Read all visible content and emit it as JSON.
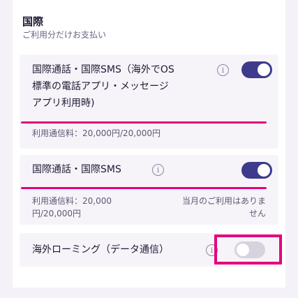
{
  "section": {
    "title": "国際",
    "subtitle": "ご利用分だけお支払い"
  },
  "rows": [
    {
      "title_lines": [
        "国際通話・国際SMS（海外でOS",
        "標準の電話アプリ・メッセージ",
        "アプリ利用時)"
      ],
      "info_icon": "info-icon",
      "toggle_state": "on",
      "fee_label": "利用通信料：20,000円/20,000円"
    },
    {
      "title": "国際通話・国際SMS",
      "info_icon": "info-icon",
      "toggle_state": "on",
      "fee_lines": [
        "利用通信料：20,000",
        "円/20,000円"
      ],
      "note_lines": [
        "当月のご利用はありま",
        "せん"
      ]
    },
    {
      "title": "海外ローミング（データ通信）",
      "info_icon": "info-icon",
      "toggle_state": "off"
    }
  ],
  "icons": {
    "info": "i"
  },
  "colors": {
    "accent_toggle_on": "#3e3a8c",
    "toggle_off": "#d6d3de",
    "highlight": "#e5007e",
    "background": "#f4f2f8"
  }
}
